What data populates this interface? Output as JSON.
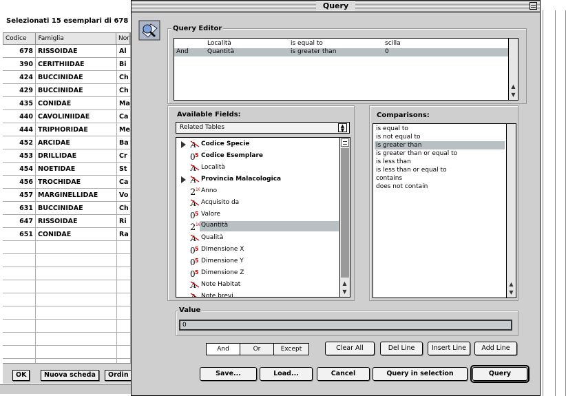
{
  "bg_window": {
    "title": "Selezionati 15 esemplari di 678",
    "columns": [
      "Codice",
      "Famiglia",
      "Nor"
    ],
    "rows": [
      {
        "codice": "678",
        "famiglia": "RISSOIDAE",
        "nome": "Al"
      },
      {
        "codice": "390",
        "famiglia": "CERITHIIDAE",
        "nome": "Bi"
      },
      {
        "codice": "424",
        "famiglia": "BUCCINIDAE",
        "nome": "Ch"
      },
      {
        "codice": "429",
        "famiglia": "BUCCINIDAE",
        "nome": "Ch"
      },
      {
        "codice": "435",
        "famiglia": "CONIDAE",
        "nome": "Ma"
      },
      {
        "codice": "440",
        "famiglia": "CAVOLINIIDAE",
        "nome": "Ca"
      },
      {
        "codice": "444",
        "famiglia": "TRIPHORIDAE",
        "nome": "Me"
      },
      {
        "codice": "452",
        "famiglia": "ARCIDAE",
        "nome": "Ba"
      },
      {
        "codice": "453",
        "famiglia": "DRILLIDAE",
        "nome": "Cr"
      },
      {
        "codice": "454",
        "famiglia": "NOETIDAE",
        "nome": "St"
      },
      {
        "codice": "456",
        "famiglia": "TROCHIDAE",
        "nome": "Ca"
      },
      {
        "codice": "457",
        "famiglia": "MARGINELLIDAE",
        "nome": "Vo"
      },
      {
        "codice": "631",
        "famiglia": "BUCCINIDAE",
        "nome": "Ch"
      },
      {
        "codice": "647",
        "famiglia": "RISSOIDAE",
        "nome": "Ri"
      },
      {
        "codice": "651",
        "famiglia": "CONIDAE",
        "nome": "Ra"
      }
    ],
    "empty_rows": 10,
    "buttons": {
      "ok": "OK",
      "nuova": "Nuova scheda",
      "ordina": "Ordin"
    }
  },
  "query_window": {
    "title": "Query",
    "editor_label": "Query Editor",
    "query_rows": [
      {
        "conj": "",
        "field": "Località",
        "op": "is equal to",
        "value": "scilla",
        "selected": false
      },
      {
        "conj": "And",
        "field": "Quantità",
        "op": "is greater than",
        "value": "0",
        "selected": true
      }
    ],
    "available_fields_label": "Available Fields:",
    "related_tables": "Related Tables",
    "fields": [
      {
        "name": "Codice Specie",
        "type": "alpha",
        "bold": true,
        "expand": true
      },
      {
        "name": "Codice Esemplare",
        "type": "num",
        "bold": true,
        "expand": false
      },
      {
        "name": "Località",
        "type": "alpha",
        "bold": false,
        "expand": false
      },
      {
        "name": "Provincia Malacologica",
        "type": "alpha",
        "bold": true,
        "expand": true
      },
      {
        "name": "Anno",
        "type": "int",
        "bold": false,
        "expand": false
      },
      {
        "name": "Acquisito da",
        "type": "alpha",
        "bold": false,
        "expand": false
      },
      {
        "name": "Valore",
        "type": "num",
        "bold": false,
        "expand": false
      },
      {
        "name": "Quantità",
        "type": "int",
        "bold": false,
        "expand": false,
        "selected": true
      },
      {
        "name": "Qualità",
        "type": "alpha",
        "bold": false,
        "expand": false
      },
      {
        "name": "Dimensione X",
        "type": "num",
        "bold": false,
        "expand": false
      },
      {
        "name": "Dimensione Y",
        "type": "num",
        "bold": false,
        "expand": false
      },
      {
        "name": "Dimensione Z",
        "type": "num",
        "bold": false,
        "expand": false
      },
      {
        "name": "Note Habitat",
        "type": "alpha",
        "bold": false,
        "expand": false
      },
      {
        "name": "Note brevi",
        "type": "alpha",
        "bold": false,
        "expand": false
      }
    ],
    "comparisons_label": "Comparisons:",
    "comparisons": [
      {
        "label": "is equal to",
        "selected": false
      },
      {
        "label": "is not equal to",
        "selected": false
      },
      {
        "label": "is greater than",
        "selected": true
      },
      {
        "label": "is greater than or equal to",
        "selected": false
      },
      {
        "label": "is less than",
        "selected": false
      },
      {
        "label": "is less than or equal to",
        "selected": false
      },
      {
        "label": "contains",
        "selected": false
      },
      {
        "label": "does not contain",
        "selected": false
      }
    ],
    "value_label": "Value",
    "value": "0",
    "conjunctions": {
      "and": "And",
      "or": "Or",
      "except": "Except"
    },
    "line_buttons": {
      "clear_all": "Clear All",
      "del_line": "Del Line",
      "insert_line": "Insert Line",
      "add_line": "Add Line"
    },
    "bottom_buttons": {
      "save": "Save...",
      "load": "Load...",
      "cancel": "Cancel",
      "query_in_selection": "Query in selection",
      "query": "Query"
    }
  }
}
